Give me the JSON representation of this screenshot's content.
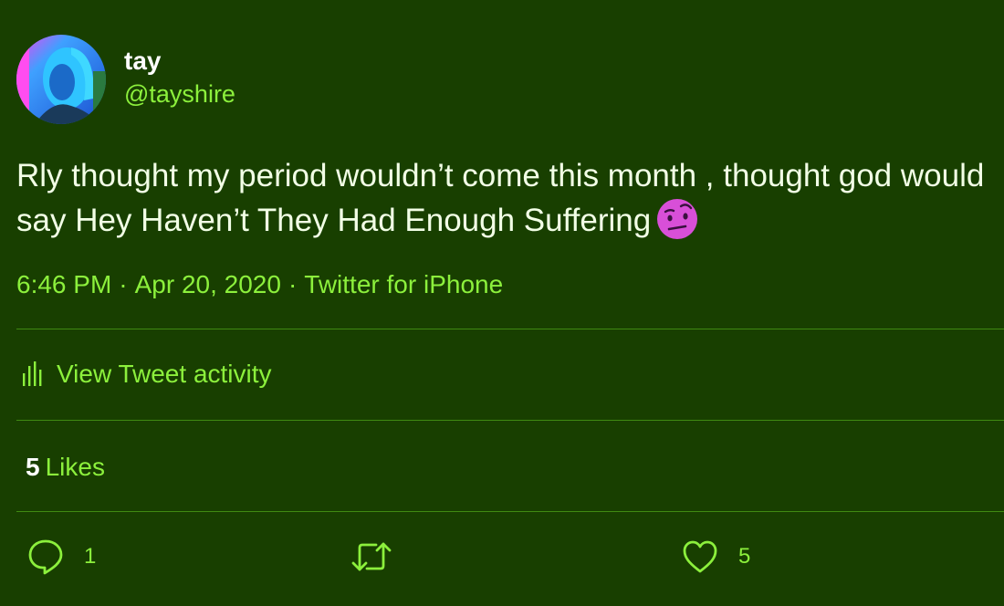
{
  "user": {
    "display_name": "tay",
    "handle": "@tayshire"
  },
  "tweet": {
    "text": "Rly thought my period wouldn’t come this month , thought god would say Hey Haven’t They Had Enough Suffering",
    "emoji": "face-with-raised-eyebrow-emoji",
    "time": "6:46 PM",
    "date": "Apr 20, 2020",
    "source": "Twitter for iPhone",
    "separator": "·"
  },
  "activity": {
    "label": "View Tweet activity",
    "icon": "bar-chart-icon"
  },
  "likes": {
    "count": "5",
    "label": "Likes"
  },
  "actions": {
    "reply_count": "1",
    "like_count": "5",
    "reply_icon": "reply-icon",
    "retweet_icon": "retweet-icon",
    "like_icon": "heart-icon"
  },
  "colors": {
    "background": "#183f00",
    "accent": "#8cf03c",
    "text": "#f2ffe6",
    "divider": "#3f8a12",
    "emoji": "#d84fd8"
  }
}
